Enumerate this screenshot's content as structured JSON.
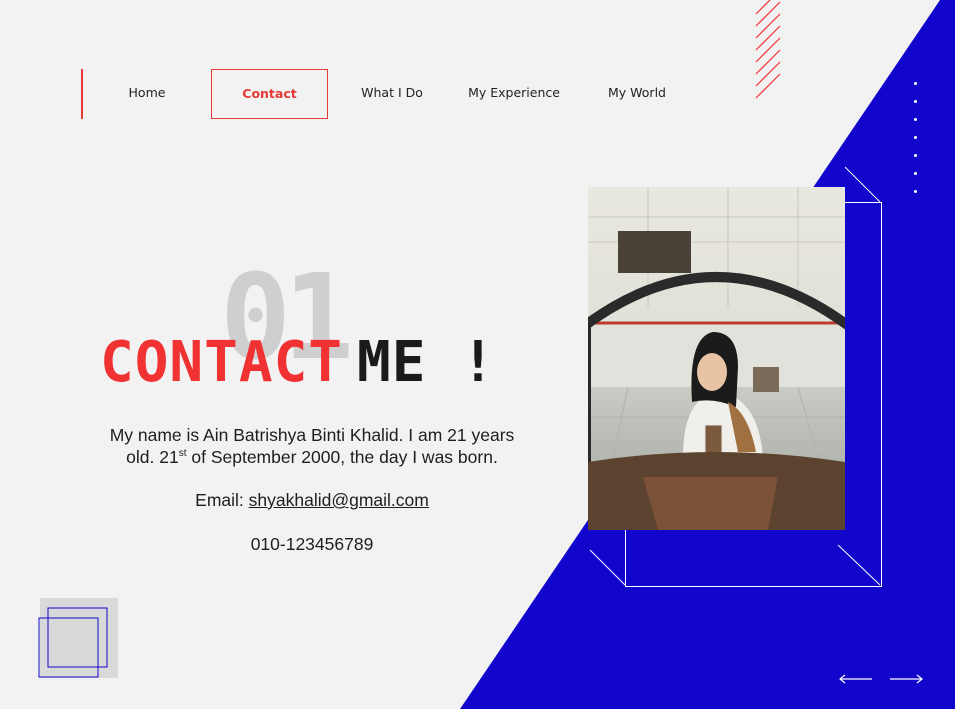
{
  "nav": {
    "items": [
      {
        "label": "Home"
      },
      {
        "label": "Contact"
      },
      {
        "label": "What I Do"
      },
      {
        "label": "My Experience"
      },
      {
        "label": "My World"
      }
    ]
  },
  "hero": {
    "number": "01",
    "heading_red": "CONTACT",
    "heading_dark": "ME !",
    "bio_line1": "My name is Ain Batrishya Binti Khalid. I am 21 years",
    "bio_line2_pre": "old. 21",
    "bio_line2_sup": "st",
    "bio_line2_post": " of September 2000, the day I was born.",
    "email_label": "Email: ",
    "email": "shyakhalid@gmail.com",
    "phone": "010-123456789"
  },
  "colors": {
    "accent_red": "#e53935",
    "blue": "#1206cc",
    "background": "#f2f2f2"
  },
  "icons": {
    "prev": "arrow-left-icon",
    "next": "arrow-right-icon"
  }
}
